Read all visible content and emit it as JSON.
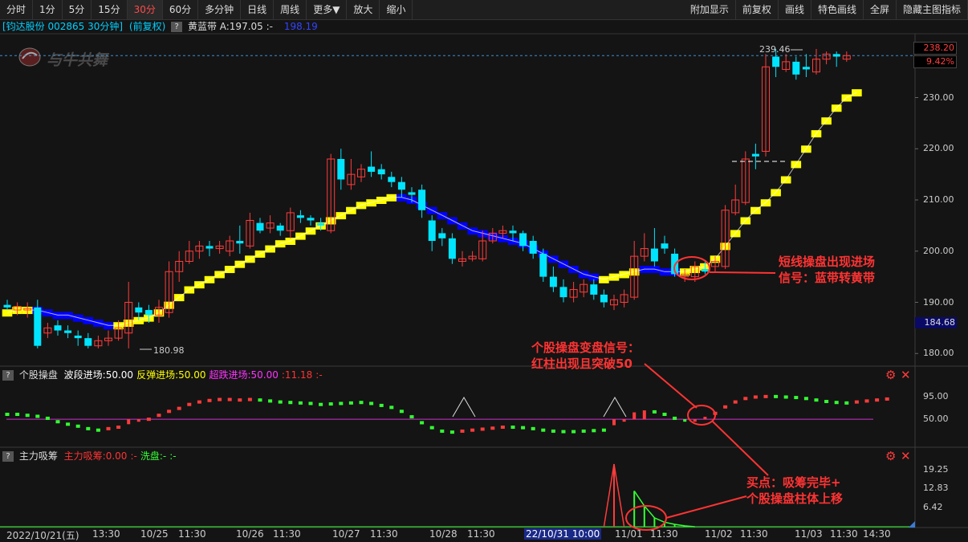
{
  "toolbar": {
    "left": [
      {
        "label": "分时",
        "active": false
      },
      {
        "label": "1分",
        "active": false
      },
      {
        "label": "5分",
        "active": false
      },
      {
        "label": "15分",
        "active": false
      },
      {
        "label": "30分",
        "active": true
      },
      {
        "label": "60分",
        "active": false
      },
      {
        "label": "多分钟",
        "active": false
      },
      {
        "label": "日线",
        "active": false
      },
      {
        "label": "周线",
        "active": false
      },
      {
        "label": "更多▼",
        "active": false
      },
      {
        "label": "放大",
        "active": false
      },
      {
        "label": "缩小",
        "active": false
      }
    ],
    "right": [
      {
        "label": "附加显示"
      },
      {
        "label": "前复权"
      },
      {
        "label": "画线"
      },
      {
        "label": "特色画线"
      },
      {
        "label": "全屏"
      },
      {
        "label": "隐藏主图指标"
      }
    ]
  },
  "infobar": {
    "stock": "[钧达股份 002865 30分钟]",
    "adjust": "(前复权)",
    "help": "?",
    "indicator": "黄蓝带 A:197.05 :-",
    "value": "198.19"
  },
  "watermark": "与牛共舞",
  "main_axis": {
    "ticks": [
      "230.00",
      "220.00",
      "210.00",
      "200.00",
      "190.00",
      "180.00"
    ],
    "current_price": "238.20",
    "current_pct": "9.42%",
    "blue_tag": "184.68",
    "high_mark": "239.46",
    "low_mark": "180.98"
  },
  "sub1": {
    "name": "个股操盘",
    "items": [
      {
        "text": "波段进场:50.00",
        "color": "#ffffff"
      },
      {
        "text": "反弹进场:50.00",
        "color": "#ffff00"
      },
      {
        "text": "超跌进场:50.00",
        "color": "#ff33ff"
      },
      {
        "text": ":11.18",
        "color": "#ff3333"
      },
      {
        "text": ":-",
        "color": "#ff3333"
      }
    ],
    "ticks": [
      "95.00",
      "50.00"
    ]
  },
  "sub2": {
    "name": "主力吸筹",
    "items": [
      {
        "text": "主力吸筹:0.00",
        "color": "#ff3333"
      },
      {
        "text": ":-",
        "color": "#ff3333"
      },
      {
        "text": "洗盘:-",
        "color": "#33ff33"
      },
      {
        "text": ":-",
        "color": "#33ff33"
      }
    ],
    "ticks": [
      "19.25",
      "12.83",
      "6.42"
    ]
  },
  "annotations": {
    "a1_line1": "短线操盘出现进场",
    "a1_line2": "信号：蓝带转黄带",
    "a2_line1": "个股操盘变盘信号：",
    "a2_line2": "红柱出现且突破50",
    "a3_line1": "买点：吸筹完毕+",
    "a3_line2": "个股操盘柱体上移"
  },
  "xaxis": [
    "2022/10/21(五)",
    "13:30",
    "10/25",
    "11:30",
    "10/26",
    "11:30",
    "10/27",
    "11:30",
    "10/28",
    "11:30",
    "22/10/31 10:00",
    "11/01",
    "11:30",
    "11/02",
    "11:30",
    "11/03",
    "11:30",
    "14:30"
  ],
  "colors": {
    "up": "#ff3b3b",
    "down": "#00e5ff",
    "yellow": "#ffff00",
    "blue": "#0000ff",
    "purple": "#cc33cc",
    "green": "#33ff33"
  },
  "chart_data": {
    "type": "candlestick",
    "ylim": [
      178,
      242
    ],
    "candles": [
      {
        "o": 189.5,
        "c": 189.0,
        "h": 190.5,
        "l": 188.5
      },
      {
        "o": 188.5,
        "c": 189.2,
        "h": 190.0,
        "l": 187.5
      },
      {
        "o": 188.5,
        "c": 188.8,
        "h": 190.0,
        "l": 187.0
      },
      {
        "o": 189.0,
        "c": 181.5,
        "h": 190.5,
        "l": 181.0
      },
      {
        "o": 184.0,
        "c": 185.0,
        "h": 186.0,
        "l": 183.0
      },
      {
        "o": 185.5,
        "c": 184.5,
        "h": 186.5,
        "l": 183.5
      },
      {
        "o": 184.5,
        "c": 184.0,
        "h": 185.5,
        "l": 183.0
      },
      {
        "o": 183.5,
        "c": 183.0,
        "h": 184.5,
        "l": 181.5
      },
      {
        "o": 183.0,
        "c": 181.5,
        "h": 184.0,
        "l": 181.0
      },
      {
        "o": 181.5,
        "c": 182.5,
        "h": 183.5,
        "l": 181.0
      },
      {
        "o": 182.5,
        "c": 183.0,
        "h": 184.5,
        "l": 181.5
      },
      {
        "o": 183.0,
        "c": 185.0,
        "h": 186.5,
        "l": 182.5
      },
      {
        "o": 184.0,
        "c": 190.0,
        "h": 194.0,
        "l": 181.0
      },
      {
        "o": 189.0,
        "c": 188.0,
        "h": 190.0,
        "l": 186.5
      },
      {
        "o": 188.5,
        "c": 187.5,
        "h": 189.5,
        "l": 186.0
      },
      {
        "o": 187.5,
        "c": 189.0,
        "h": 190.5,
        "l": 186.0
      },
      {
        "o": 188.0,
        "c": 196.0,
        "h": 198.0,
        "l": 187.0
      },
      {
        "o": 196.0,
        "c": 198.0,
        "h": 200.0,
        "l": 194.0
      },
      {
        "o": 198.0,
        "c": 200.0,
        "h": 202.0,
        "l": 197.5
      },
      {
        "o": 200.0,
        "c": 201.0,
        "h": 202.0,
        "l": 198.5
      },
      {
        "o": 201.0,
        "c": 200.5,
        "h": 202.0,
        "l": 199.0
      },
      {
        "o": 200.5,
        "c": 201.0,
        "h": 202.0,
        "l": 199.5
      },
      {
        "o": 200.0,
        "c": 202.0,
        "h": 203.0,
        "l": 199.0
      },
      {
        "o": 202.0,
        "c": 201.5,
        "h": 205.0,
        "l": 199.5
      },
      {
        "o": 201.0,
        "c": 206.0,
        "h": 207.5,
        "l": 200.5
      },
      {
        "o": 205.5,
        "c": 204.0,
        "h": 206.5,
        "l": 203.5
      },
      {
        "o": 204.5,
        "c": 205.5,
        "h": 207.0,
        "l": 203.5
      },
      {
        "o": 205.0,
        "c": 204.0,
        "h": 205.5,
        "l": 203.0
      },
      {
        "o": 204.0,
        "c": 207.5,
        "h": 208.5,
        "l": 202.5
      },
      {
        "o": 207.0,
        "c": 206.5,
        "h": 208.0,
        "l": 205.5
      },
      {
        "o": 206.5,
        "c": 206.0,
        "h": 207.0,
        "l": 205.0
      },
      {
        "o": 205.5,
        "c": 205.0,
        "h": 206.5,
        "l": 204.0
      },
      {
        "o": 204.0,
        "c": 218.0,
        "h": 219.0,
        "l": 203.5
      },
      {
        "o": 218.0,
        "c": 214.0,
        "h": 220.0,
        "l": 212.0
      },
      {
        "o": 213.0,
        "c": 215.0,
        "h": 218.0,
        "l": 212.0
      },
      {
        "o": 214.5,
        "c": 216.0,
        "h": 217.0,
        "l": 213.5
      },
      {
        "o": 216.5,
        "c": 215.5,
        "h": 219.5,
        "l": 214.5
      },
      {
        "o": 216.0,
        "c": 215.0,
        "h": 217.0,
        "l": 214.0
      },
      {
        "o": 214.5,
        "c": 213.5,
        "h": 215.5,
        "l": 212.5
      },
      {
        "o": 213.5,
        "c": 212.0,
        "h": 214.5,
        "l": 210.5
      },
      {
        "o": 211.5,
        "c": 211.0,
        "h": 212.5,
        "l": 209.5
      },
      {
        "o": 212.0,
        "c": 208.0,
        "h": 213.0,
        "l": 206.5
      },
      {
        "o": 206.0,
        "c": 202.0,
        "h": 207.0,
        "l": 200.0
      },
      {
        "o": 203.5,
        "c": 202.5,
        "h": 204.5,
        "l": 201.0
      },
      {
        "o": 202.5,
        "c": 198.5,
        "h": 203.5,
        "l": 197.5
      },
      {
        "o": 198.0,
        "c": 198.5,
        "h": 200.0,
        "l": 197.0
      },
      {
        "o": 198.5,
        "c": 199.0,
        "h": 200.0,
        "l": 198.0
      },
      {
        "o": 198.5,
        "c": 202.0,
        "h": 204.0,
        "l": 198.0
      },
      {
        "o": 202.0,
        "c": 203.5,
        "h": 204.5,
        "l": 201.5
      },
      {
        "o": 203.5,
        "c": 204.0,
        "h": 205.0,
        "l": 202.5
      },
      {
        "o": 204.0,
        "c": 203.5,
        "h": 205.0,
        "l": 202.0
      },
      {
        "o": 203.5,
        "c": 201.0,
        "h": 204.0,
        "l": 200.0
      },
      {
        "o": 202.0,
        "c": 199.5,
        "h": 203.0,
        "l": 198.5
      },
      {
        "o": 199.5,
        "c": 195.0,
        "h": 200.5,
        "l": 194.0
      },
      {
        "o": 195.0,
        "c": 193.0,
        "h": 197.0,
        "l": 192.0
      },
      {
        "o": 193.0,
        "c": 191.0,
        "h": 194.5,
        "l": 190.0
      },
      {
        "o": 191.0,
        "c": 192.5,
        "h": 194.0,
        "l": 190.0
      },
      {
        "o": 192.0,
        "c": 193.5,
        "h": 194.5,
        "l": 191.0
      },
      {
        "o": 193.5,
        "c": 191.5,
        "h": 194.5,
        "l": 190.5
      },
      {
        "o": 191.5,
        "c": 190.0,
        "h": 192.5,
        "l": 189.0
      },
      {
        "o": 189.5,
        "c": 190.5,
        "h": 191.5,
        "l": 188.5
      },
      {
        "o": 190.0,
        "c": 191.5,
        "h": 192.5,
        "l": 189.0
      },
      {
        "o": 191.0,
        "c": 199.0,
        "h": 202.0,
        "l": 190.5
      },
      {
        "o": 199.0,
        "c": 200.5,
        "h": 203.5,
        "l": 198.0
      },
      {
        "o": 200.5,
        "c": 198.0,
        "h": 204.5,
        "l": 197.0
      },
      {
        "o": 201.5,
        "c": 200.5,
        "h": 203.0,
        "l": 199.5
      },
      {
        "o": 199.5,
        "c": 195.5,
        "h": 200.5,
        "l": 195.0
      },
      {
        "o": 195.0,
        "c": 195.5,
        "h": 196.5,
        "l": 194.0
      },
      {
        "o": 195.0,
        "c": 197.0,
        "h": 198.0,
        "l": 194.0
      },
      {
        "o": 196.5,
        "c": 196.0,
        "h": 198.0,
        "l": 195.5
      },
      {
        "o": 197.0,
        "c": 198.0,
        "h": 199.0,
        "l": 196.0
      },
      {
        "o": 197.0,
        "c": 208.0,
        "h": 209.0,
        "l": 196.5
      },
      {
        "o": 207.5,
        "c": 210.0,
        "h": 213.0,
        "l": 207.0
      },
      {
        "o": 209.5,
        "c": 218.0,
        "h": 219.5,
        "l": 209.0
      },
      {
        "o": 219.0,
        "c": 218.5,
        "h": 221.0,
        "l": 216.0
      },
      {
        "o": 219.5,
        "c": 236.0,
        "h": 238.5,
        "l": 218.5
      },
      {
        "o": 238.0,
        "c": 236.0,
        "h": 239.5,
        "l": 234.0
      },
      {
        "o": 235.5,
        "c": 237.0,
        "h": 238.5,
        "l": 235.0
      },
      {
        "o": 237.0,
        "c": 234.5,
        "h": 238.0,
        "l": 233.5
      },
      {
        "o": 236.0,
        "c": 235.5,
        "h": 238.5,
        "l": 234.0
      },
      {
        "o": 235.0,
        "c": 237.5,
        "h": 239.5,
        "l": 234.5
      },
      {
        "o": 237.5,
        "c": 238.5,
        "h": 239.0,
        "l": 236.5
      },
      {
        "o": 238.5,
        "c": 238.0,
        "h": 239.0,
        "l": 236.0
      },
      {
        "o": 237.5,
        "c": 238.2,
        "h": 239.0,
        "l": 237.0
      }
    ],
    "band": [
      {
        "v": 188.0,
        "c": "y"
      },
      {
        "v": 188.5,
        "c": "y"
      },
      {
        "v": 188.5,
        "c": "y"
      },
      {
        "v": 188.5,
        "c": "b"
      },
      {
        "v": 188.0,
        "c": "b"
      },
      {
        "v": 187.5,
        "c": "b"
      },
      {
        "v": 187.5,
        "c": "b"
      },
      {
        "v": 187.0,
        "c": "b"
      },
      {
        "v": 186.5,
        "c": "b"
      },
      {
        "v": 186.0,
        "c": "b"
      },
      {
        "v": 185.5,
        "c": "b"
      },
      {
        "v": 185.5,
        "c": "y"
      },
      {
        "v": 186.0,
        "c": "y"
      },
      {
        "v": 186.5,
        "c": "y"
      },
      {
        "v": 187.0,
        "c": "y"
      },
      {
        "v": 188.0,
        "c": "y"
      },
      {
        "v": 189.5,
        "c": "y"
      },
      {
        "v": 191.0,
        "c": "y"
      },
      {
        "v": 192.5,
        "c": "y"
      },
      {
        "v": 193.5,
        "c": "y"
      },
      {
        "v": 194.5,
        "c": "y"
      },
      {
        "v": 195.5,
        "c": "y"
      },
      {
        "v": 196.5,
        "c": "y"
      },
      {
        "v": 197.5,
        "c": "y"
      },
      {
        "v": 198.5,
        "c": "y"
      },
      {
        "v": 199.5,
        "c": "y"
      },
      {
        "v": 200.5,
        "c": "y"
      },
      {
        "v": 201.5,
        "c": "y"
      },
      {
        "v": 202.0,
        "c": "y"
      },
      {
        "v": 203.0,
        "c": "y"
      },
      {
        "v": 204.0,
        "c": "y"
      },
      {
        "v": 205.0,
        "c": "y"
      },
      {
        "v": 206.0,
        "c": "y"
      },
      {
        "v": 207.0,
        "c": "y"
      },
      {
        "v": 208.0,
        "c": "y"
      },
      {
        "v": 209.0,
        "c": "y"
      },
      {
        "v": 209.5,
        "c": "y"
      },
      {
        "v": 210.0,
        "c": "y"
      },
      {
        "v": 210.5,
        "c": "y"
      },
      {
        "v": 210.5,
        "c": "b"
      },
      {
        "v": 210.0,
        "c": "b"
      },
      {
        "v": 209.0,
        "c": "b"
      },
      {
        "v": 208.0,
        "c": "b"
      },
      {
        "v": 207.0,
        "c": "b"
      },
      {
        "v": 206.0,
        "c": "b"
      },
      {
        "v": 205.0,
        "c": "b"
      },
      {
        "v": 204.0,
        "c": "b"
      },
      {
        "v": 203.5,
        "c": "b"
      },
      {
        "v": 203.0,
        "c": "b"
      },
      {
        "v": 202.5,
        "c": "b"
      },
      {
        "v": 202.0,
        "c": "b"
      },
      {
        "v": 201.5,
        "c": "b"
      },
      {
        "v": 200.5,
        "c": "b"
      },
      {
        "v": 199.5,
        "c": "b"
      },
      {
        "v": 198.5,
        "c": "b"
      },
      {
        "v": 197.5,
        "c": "b"
      },
      {
        "v": 196.5,
        "c": "b"
      },
      {
        "v": 195.5,
        "c": "b"
      },
      {
        "v": 195.0,
        "c": "b"
      },
      {
        "v": 194.5,
        "c": "y"
      },
      {
        "v": 195.0,
        "c": "y"
      },
      {
        "v": 195.5,
        "c": "y"
      },
      {
        "v": 196.0,
        "c": "y"
      },
      {
        "v": 196.5,
        "c": "b"
      },
      {
        "v": 196.5,
        "c": "b"
      },
      {
        "v": 196.0,
        "c": "b"
      },
      {
        "v": 196.0,
        "c": "b"
      },
      {
        "v": 196.0,
        "c": "y"
      },
      {
        "v": 196.5,
        "c": "y"
      },
      {
        "v": 197.0,
        "c": "y"
      },
      {
        "v": 198.5,
        "c": "y"
      },
      {
        "v": 201.0,
        "c": "y"
      },
      {
        "v": 203.5,
        "c": "y"
      },
      {
        "v": 206.0,
        "c": "y"
      },
      {
        "v": 208.0,
        "c": "y"
      },
      {
        "v": 209.5,
        "c": "y"
      },
      {
        "v": 211.5,
        "c": "y"
      },
      {
        "v": 214.0,
        "c": "y"
      },
      {
        "v": 217.0,
        "c": "y"
      },
      {
        "v": 220.0,
        "c": "y"
      },
      {
        "v": 223.0,
        "c": "y"
      },
      {
        "v": 225.5,
        "c": "y"
      },
      {
        "v": 228.0,
        "c": "y"
      },
      {
        "v": 230.0,
        "c": "y"
      },
      {
        "v": 231.0,
        "c": "y"
      }
    ],
    "sub1_series": {
      "ylim": [
        -5,
        125
      ],
      "values": [
        60,
        60,
        58,
        56,
        52,
        45,
        40,
        36,
        31,
        28,
        31,
        34,
        40,
        45,
        50,
        58,
        66,
        72,
        80,
        85,
        88,
        90,
        90,
        89,
        90,
        89,
        87,
        85,
        84,
        83,
        82,
        80,
        81,
        82,
        83,
        84,
        82,
        78,
        74,
        66,
        55,
        43,
        33,
        26,
        24,
        26,
        28,
        30,
        32,
        34,
        34,
        33,
        31,
        28,
        26,
        25,
        25,
        26,
        27,
        28,
        38,
        50,
        64,
        68,
        65,
        60,
        52,
        49,
        50,
        55,
        62,
        75,
        85,
        92,
        95,
        96,
        96,
        95,
        94,
        92,
        89,
        86,
        84,
        83,
        85,
        87,
        89,
        91
      ],
      "colors": [
        "g",
        "g",
        "g",
        "g",
        "g",
        "g",
        "g",
        "g",
        "g",
        "g",
        "r",
        "r",
        "r",
        "r",
        "r",
        "r",
        "r",
        "r",
        "r",
        "r",
        "r",
        "r",
        "r",
        "r",
        "r",
        "g",
        "g",
        "g",
        "g",
        "g",
        "g",
        "g",
        "g",
        "g",
        "g",
        "g",
        "g",
        "g",
        "g",
        "g",
        "g",
        "g",
        "g",
        "g",
        "g",
        "r",
        "r",
        "r",
        "r",
        "r",
        "g",
        "g",
        "g",
        "g",
        "g",
        "g",
        "g",
        "g",
        "g",
        "g",
        "r",
        "r",
        "r",
        "r",
        "g",
        "g",
        "g",
        "g",
        "r",
        "r",
        "r",
        "r",
        "r",
        "r",
        "r",
        "r",
        "g",
        "g",
        "g",
        "g",
        "g",
        "g",
        "g",
        "g",
        "r",
        "r",
        "r",
        "r"
      ]
    },
    "sub2_series": {
      "ylim": [
        0,
        21
      ],
      "values": [
        0,
        0,
        0,
        0,
        0,
        0,
        0,
        0,
        0,
        0,
        0,
        0,
        0,
        0,
        0,
        0,
        0,
        0,
        0,
        0,
        0,
        0,
        0,
        0,
        0,
        0,
        0,
        0,
        0,
        0,
        0,
        0,
        0,
        0,
        0,
        0,
        0,
        0,
        0,
        0,
        0,
        0,
        0,
        0,
        0,
        0,
        0,
        0,
        0,
        0,
        0,
        0,
        0,
        0,
        0,
        0,
        0,
        0,
        0,
        0,
        21,
        0,
        12,
        7,
        3,
        1.5,
        0.8,
        0.3,
        0,
        0,
        0,
        0,
        0,
        0,
        0,
        0,
        0,
        0,
        0,
        0,
        0,
        0,
        0,
        0,
        0,
        0,
        0,
        0
      ]
    }
  }
}
